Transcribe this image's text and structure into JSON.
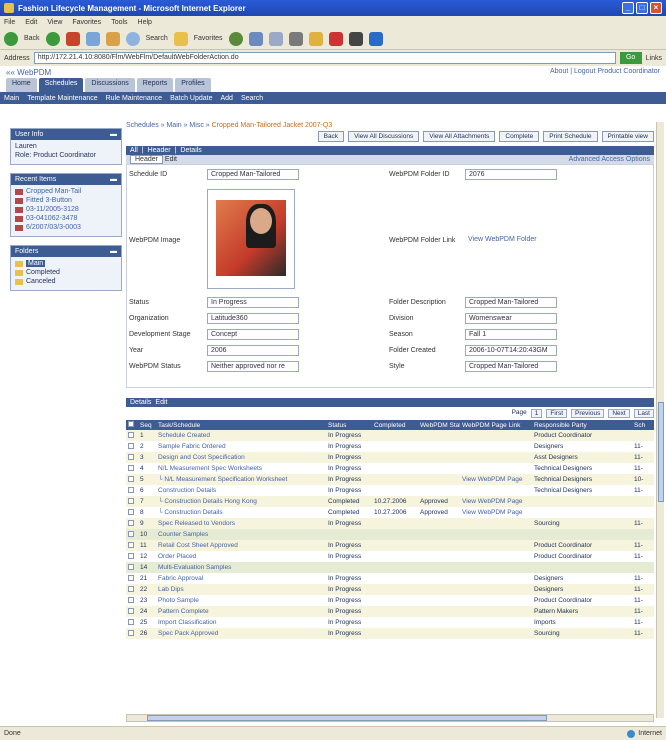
{
  "window": {
    "title": "Fashion Lifecycle Management - Microsoft Internet Explorer"
  },
  "menubar": [
    "File",
    "Edit",
    "View",
    "Favorites",
    "Tools",
    "Help"
  ],
  "toolbar": {
    "back": "Back",
    "search": "Search",
    "favorites": "Favorites"
  },
  "addressbar": {
    "label": "Address",
    "url": "http://172.21.4.10:8080/Flm/WebFlm/DefaultWebFolderAction.do",
    "go": "Go",
    "links": "Links"
  },
  "app": {
    "brand": "«« WebPDM",
    "about": "About | Logout  Product Coordinator",
    "tabs": [
      "Home",
      "Schedules",
      "Discussions",
      "Reports",
      "Profiles"
    ],
    "subnav": [
      "Main",
      "Template Maintenance",
      "Rule Maintenance",
      "Batch Update",
      "Add",
      "Search"
    ]
  },
  "sidebar": {
    "user_info": {
      "title": "User Info",
      "lines": [
        "Lauren",
        "Role: Product Coordinator"
      ]
    },
    "recent_items": {
      "title": "Recent Items",
      "items": [
        "Cropped Man-Tail",
        "Fitted 3-Button",
        "03-11/2005-3128",
        "03-041062-3478",
        "6/2007/03/3-0003"
      ]
    },
    "folders": {
      "title": "Folders",
      "items": [
        "Main",
        "Completed",
        "Canceled"
      ]
    }
  },
  "content": {
    "breadcrumb": "Schedules » Main » Misc » ",
    "breadcrumb_current": "Cropped Man-Tailored Jacket 2007-Q3",
    "actions": [
      "Back",
      "View All Discussions",
      "View All Attachments",
      "Complete",
      "Print Schedule",
      "Printable view"
    ],
    "section_tabs": [
      "All",
      "Header",
      "Details"
    ],
    "header_tab": "Header",
    "edit_label": "Edit",
    "advanced": "Advanced Access Options",
    "fields": {
      "schedule_id_label": "Schedule ID",
      "schedule_id": "Cropped Man-Tailored",
      "webpdm_image_label": "WebPDM Image",
      "status_label": "Status",
      "status": "In Progress",
      "organization_label": "Organization",
      "organization": "Latitude360",
      "dev_stage_label": "Development Stage",
      "dev_stage": "Concept",
      "year_label": "Year",
      "year": "2006",
      "webpdm_status_label": "WebPDM Status",
      "webpdm_status": "Neither approved nor re",
      "folder_id_label": "WebPDM Folder ID",
      "folder_id": "2076",
      "folder_link_label": "WebPDM Folder Link",
      "folder_link": "View WebPDM Folder",
      "folder_desc_label": "Folder Description",
      "folder_desc": "Cropped Man-Tailored",
      "division_label": "Division",
      "division": "Womenswear",
      "season_label": "Season",
      "season": "Fall 1",
      "folder_created_label": "Folder Created",
      "folder_created": "2006-10-07T14:20:43GM",
      "style_label": "Style",
      "style": "Cropped Man-Tailored"
    },
    "details_label": "Details",
    "pager": {
      "page_label": "Page",
      "page": "1",
      "buttons": [
        "First",
        "Previous",
        "Next",
        "Last"
      ]
    },
    "columns": [
      "",
      "Seq",
      "Task/Schedule",
      "Status",
      "Completed",
      "WebPDM Status",
      "WebPDM Page Link",
      "Responsible Party",
      "Sch"
    ],
    "rows": [
      {
        "seq": "1",
        "task": "Schedule Created",
        "status": "In Progress",
        "completed": "",
        "wstatus": "",
        "link": "",
        "party": "Product Coordinator",
        "sch": "",
        "type": "task"
      },
      {
        "seq": "2",
        "task": "Sample Fabric Ordered",
        "status": "In Progress",
        "completed": "",
        "wstatus": "",
        "link": "",
        "party": "Designers",
        "sch": "11-",
        "type": "task"
      },
      {
        "seq": "3",
        "task": "Design and Cost Specification",
        "status": "In Progress",
        "completed": "",
        "wstatus": "",
        "link": "",
        "party": "Asst Designers",
        "sch": "11-",
        "type": "task"
      },
      {
        "seq": "4",
        "task": "N/L Measurement Spec Worksheets",
        "status": "In Progress",
        "completed": "",
        "wstatus": "",
        "link": "",
        "party": "Technical Designers",
        "sch": "11-",
        "type": "task"
      },
      {
        "seq": "5",
        "task": "└ N/L Measurement Specification Worksheet",
        "status": "In Progress",
        "completed": "",
        "wstatus": "",
        "link": "View WebPDM Page",
        "party": "Technical Designers",
        "sch": "10-",
        "type": "task"
      },
      {
        "seq": "6",
        "task": "Construction Details",
        "status": "In Progress",
        "completed": "",
        "wstatus": "",
        "link": "",
        "party": "Technical Designers",
        "sch": "11-",
        "type": "task"
      },
      {
        "seq": "7",
        "task": "└ Construction Details Hong Kong",
        "status": "Completed",
        "completed": "10.27.2006",
        "wstatus": "Approved",
        "link": "View WebPDM Page",
        "party": "",
        "sch": "",
        "type": "task"
      },
      {
        "seq": "8",
        "task": "└ Construction Details",
        "status": "Completed",
        "completed": "10.27.2006",
        "wstatus": "Approved",
        "link": "View WebPDM Page",
        "party": "",
        "sch": "",
        "type": "task"
      },
      {
        "seq": "9",
        "task": "Spec Released to Vendors",
        "status": "In Progress",
        "completed": "",
        "wstatus": "",
        "link": "",
        "party": "Sourcing",
        "sch": "11-",
        "type": "task"
      },
      {
        "seq": "10",
        "task": "Counter Samples",
        "status": "",
        "completed": "",
        "wstatus": "",
        "link": "",
        "party": "",
        "sch": "",
        "type": "grp"
      },
      {
        "seq": "11",
        "task": "Retail Cost Sheet Approved",
        "status": "In Progress",
        "completed": "",
        "wstatus": "",
        "link": "",
        "party": "Product Coordinator",
        "sch": "11-",
        "type": "task"
      },
      {
        "seq": "12",
        "task": "Order Placed",
        "status": "In Progress",
        "completed": "",
        "wstatus": "",
        "link": "",
        "party": "Product Coordinator",
        "sch": "11-",
        "type": "task"
      },
      {
        "seq": "14",
        "task": "Multi-Evaluation Samples",
        "status": "",
        "completed": "",
        "wstatus": "",
        "link": "",
        "party": "",
        "sch": "",
        "type": "grp"
      },
      {
        "seq": "21",
        "task": "Fabric Approval",
        "status": "In Progress",
        "completed": "",
        "wstatus": "",
        "link": "",
        "party": "Designers",
        "sch": "11-",
        "type": "task"
      },
      {
        "seq": "22",
        "task": "Lab Dips",
        "status": "In Progress",
        "completed": "",
        "wstatus": "",
        "link": "",
        "party": "Designers",
        "sch": "11-",
        "type": "task"
      },
      {
        "seq": "23",
        "task": "Photo Sample",
        "status": "In Progress",
        "completed": "",
        "wstatus": "",
        "link": "",
        "party": "Product Coordinator",
        "sch": "11-",
        "type": "task"
      },
      {
        "seq": "24",
        "task": "Pattern Complete",
        "status": "In Progress",
        "completed": "",
        "wstatus": "",
        "link": "",
        "party": "Pattern Makers",
        "sch": "11-",
        "type": "task"
      },
      {
        "seq": "25",
        "task": "Import Classification",
        "status": "In Progress",
        "completed": "",
        "wstatus": "",
        "link": "",
        "party": "Imports",
        "sch": "11-",
        "type": "task"
      },
      {
        "seq": "26",
        "task": "Spec Pack Approved",
        "status": "In Progress",
        "completed": "",
        "wstatus": "",
        "link": "",
        "party": "Sourcing",
        "sch": "11-",
        "type": "task"
      }
    ]
  },
  "statusbar": {
    "left": "Done",
    "zone": "Internet"
  }
}
